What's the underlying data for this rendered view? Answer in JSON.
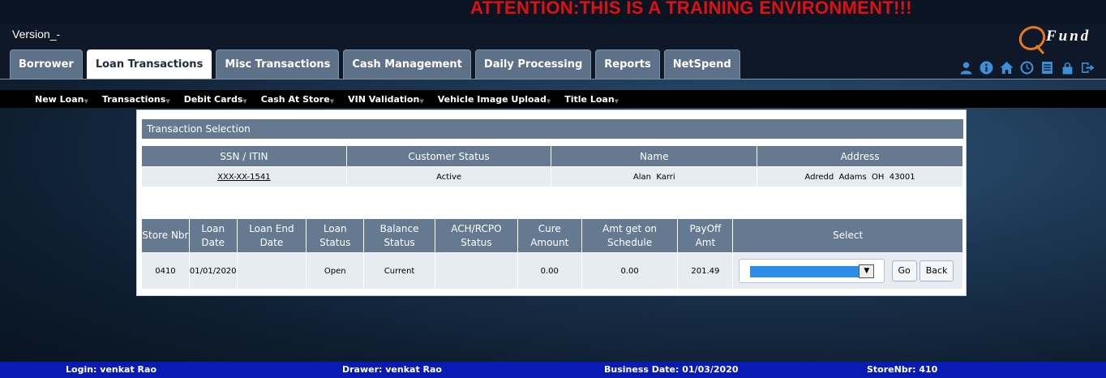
{
  "banner": {
    "attention": "ATTENTION:THIS IS A TRAINING ENVIRONMENT!!!"
  },
  "header": {
    "version": "Version_-",
    "logo_text": "Fund"
  },
  "tabs": [
    {
      "label": "Borrower",
      "active": false
    },
    {
      "label": "Loan Transactions",
      "active": true
    },
    {
      "label": "Misc Transactions",
      "active": false
    },
    {
      "label": "Cash Management",
      "active": false
    },
    {
      "label": "Daily Processing",
      "active": false
    },
    {
      "label": "Reports",
      "active": false
    },
    {
      "label": "NetSpend",
      "active": false
    }
  ],
  "toolbar_icons": [
    "user-icon",
    "info-icon",
    "home-icon",
    "clock-icon",
    "document-icon",
    "lock-icon",
    "logout-icon"
  ],
  "submenu": [
    {
      "label": "New Loan"
    },
    {
      "label": "Transactions"
    },
    {
      "label": "Debit Cards"
    },
    {
      "label": "Cash At Store"
    },
    {
      "label": "VIN Validation"
    },
    {
      "label": "Vehicle Image Upload"
    },
    {
      "label": "Title Loan"
    }
  ],
  "panel": {
    "title": "Transaction Selection"
  },
  "customer_table": {
    "headers": [
      "SSN / ITIN",
      "Customer Status",
      "Name",
      "Address"
    ],
    "row": {
      "ssn": "XXX-XX-1541",
      "status": "Active",
      "name": "Alan  Karri",
      "address": "Adredd  Adams  OH  43001"
    }
  },
  "loan_table": {
    "headers": [
      "Store Nbr",
      "Loan Date",
      "Loan End Date",
      "Loan Status",
      "Balance Status",
      "ACH/RCPO Status",
      "Cure Amount",
      "Amt get on Schedule",
      "PayOff Amt",
      "Select"
    ],
    "row": {
      "store_nbr": "0410",
      "loan_date": "01/01/2020",
      "loan_end_date": "",
      "loan_status": "Open",
      "balance_status": "Current",
      "ach_status": "",
      "cure_amount": "0.00",
      "amt_schedule": "0.00",
      "payoff_amt": "201.49",
      "select_value": ""
    },
    "go_label": "Go",
    "back_label": "Back"
  },
  "footer": {
    "login": "Login: venkat Rao",
    "drawer": "Drawer: venkat Rao",
    "business_date": "Business Date: 01/03/2020",
    "store": "StoreNbr: 410"
  },
  "colors": {
    "attention": "#e01010",
    "tab": "#5d7188",
    "table_header": "#657a91",
    "footer": "#0a1bb4",
    "icon": "#3e8fd6",
    "select_highlight": "#2c8de8"
  }
}
